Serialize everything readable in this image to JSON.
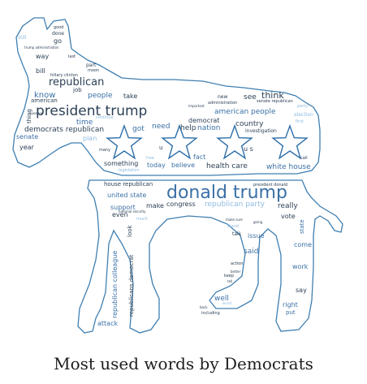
{
  "caption": "Most used words by Democrats",
  "colors": {
    "outline": "#3f7fb1",
    "star": "#2d6ea8",
    "word_dark": "#2b3f55",
    "word_mid": "#3a70a6",
    "word_light": "#8fbbe0"
  },
  "words": [
    {
      "text": "donald trump",
      "tone": "mid"
    },
    {
      "text": "president trump",
      "tone": "dark"
    },
    {
      "text": "republican",
      "tone": "dark"
    },
    {
      "text": "think",
      "tone": "dark"
    },
    {
      "text": "american people",
      "tone": "mid"
    },
    {
      "text": "democrats republican",
      "tone": "dark"
    },
    {
      "text": "people",
      "tone": "mid"
    },
    {
      "text": "know",
      "tone": "mid"
    },
    {
      "text": "take",
      "tone": "dark"
    },
    {
      "text": "see",
      "tone": "dark"
    },
    {
      "text": "democrat",
      "tone": "dark"
    },
    {
      "text": "country",
      "tone": "dark"
    },
    {
      "text": "nation",
      "tone": "mid"
    },
    {
      "text": "help",
      "tone": "dark"
    },
    {
      "text": "need",
      "tone": "mid"
    },
    {
      "text": "got",
      "tone": "mid"
    },
    {
      "text": "time",
      "tone": "mid"
    },
    {
      "text": "plan",
      "tone": "light"
    },
    {
      "text": "senate",
      "tone": "mid"
    },
    {
      "text": "year",
      "tone": "dark"
    },
    {
      "text": "thing",
      "tone": "dark"
    },
    {
      "text": "american",
      "tone": "dark"
    },
    {
      "text": "bill",
      "tone": "dark"
    },
    {
      "text": "way",
      "tone": "dark"
    },
    {
      "text": "go",
      "tone": "dark"
    },
    {
      "text": "today",
      "tone": "mid"
    },
    {
      "text": "believe",
      "tone": "mid"
    },
    {
      "text": "health care",
      "tone": "dark"
    },
    {
      "text": "white house",
      "tone": "mid"
    },
    {
      "text": "fact",
      "tone": "mid"
    },
    {
      "text": "something",
      "tone": "dark"
    },
    {
      "text": "house republican",
      "tone": "dark"
    },
    {
      "text": "united state",
      "tone": "mid"
    },
    {
      "text": "support",
      "tone": "mid"
    },
    {
      "text": "make",
      "tone": "dark"
    },
    {
      "text": "congress",
      "tone": "dark"
    },
    {
      "text": "republican party",
      "tone": "light"
    },
    {
      "text": "really",
      "tone": "dark"
    },
    {
      "text": "vote",
      "tone": "dark"
    },
    {
      "text": "even",
      "tone": "dark"
    },
    {
      "text": "issue",
      "tone": "mid"
    },
    {
      "text": "said",
      "tone": "mid"
    },
    {
      "text": "come",
      "tone": "mid"
    },
    {
      "text": "work",
      "tone": "mid"
    },
    {
      "text": "say",
      "tone": "dark"
    },
    {
      "text": "well",
      "tone": "mid"
    },
    {
      "text": "right",
      "tone": "mid"
    },
    {
      "text": "put",
      "tone": "mid"
    },
    {
      "text": "attack",
      "tone": "mid"
    },
    {
      "text": "republican colleague",
      "tone": "mid"
    },
    {
      "text": "republicans democrat",
      "tone": "dark"
    },
    {
      "text": "look",
      "tone": "dark"
    },
    {
      "text": "state",
      "tone": "mid"
    },
    {
      "text": "job",
      "tone": "dark"
    },
    {
      "text": "part",
      "tone": "dark"
    },
    {
      "text": "u s",
      "tone": "dark"
    },
    {
      "text": "u",
      "tone": "dark"
    },
    {
      "text": "new",
      "tone": "dark"
    },
    {
      "text": "administration",
      "tone": "dark"
    },
    {
      "text": "still",
      "tone": "light"
    },
    {
      "text": "done",
      "tone": "dark"
    },
    {
      "text": "good",
      "tone": "dark"
    },
    {
      "text": "investigation",
      "tone": "dark"
    },
    {
      "text": "election",
      "tone": "light"
    },
    {
      "text": "party",
      "tone": "light"
    },
    {
      "text": "first",
      "tone": "light"
    },
    {
      "text": "call",
      "tone": "dark"
    },
    {
      "text": "many",
      "tone": "dark"
    },
    {
      "text": "legislation",
      "tone": "light"
    },
    {
      "text": "talk",
      "tone": "dark"
    },
    {
      "text": "action",
      "tone": "dark"
    },
    {
      "text": "stand",
      "tone": "light"
    },
    {
      "text": "much",
      "tone": "light"
    },
    {
      "text": "hillary clinton",
      "tone": "dark"
    },
    {
      "text": "senate republican",
      "tone": "dark"
    },
    {
      "text": "question",
      "tone": "dark"
    },
    {
      "text": "continue",
      "tone": "light"
    },
    {
      "text": "trump administration",
      "tone": "dark"
    },
    {
      "text": "president donald",
      "tone": "dark"
    },
    {
      "text": "back",
      "tone": "dark"
    },
    {
      "text": "last",
      "tone": "dark"
    },
    {
      "text": "moon",
      "tone": "dark"
    },
    {
      "text": "important",
      "tone": "dark"
    },
    {
      "text": "free",
      "tone": "light"
    },
    {
      "text": "including",
      "tone": "dark"
    },
    {
      "text": "keep",
      "tone": "dark"
    },
    {
      "text": "tell",
      "tone": "dark"
    },
    {
      "text": "better",
      "tone": "dark"
    },
    {
      "text": "national security",
      "tone": "dark"
    },
    {
      "text": "make sure",
      "tone": "dark"
    },
    {
      "text": "going",
      "tone": "dark"
    },
    {
      "text": "world",
      "tone": "light"
    }
  ]
}
